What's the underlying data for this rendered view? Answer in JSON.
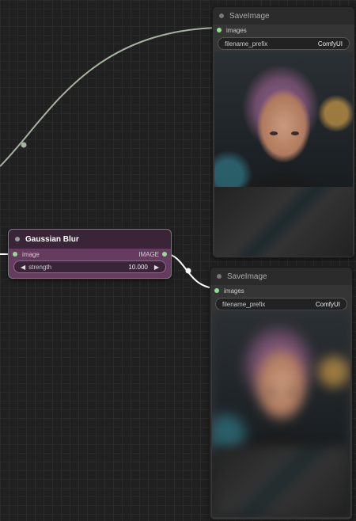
{
  "nodes": {
    "save_top": {
      "title": "SaveImage",
      "input_label": "images",
      "widget_label": "filename_prefix",
      "widget_value": "ComfyUI"
    },
    "blur": {
      "title": "Gaussian Blur",
      "input_label": "image",
      "output_label": "IMAGE",
      "widget_label": "strength",
      "widget_value": "10.000",
      "decrement_glyph": "◀",
      "increment_glyph": "▶"
    },
    "save_bottom": {
      "title": "SaveImage",
      "input_label": "images",
      "widget_label": "filename_prefix",
      "widget_value": "ComfyUI"
    }
  },
  "colors": {
    "canvas": "#202020",
    "node_bg": "#353535",
    "blur_node_bg": "#653c5f",
    "link_top": "#a7b3a2",
    "link_bottom": "#ffffff",
    "slot_dot": "#8ee08e"
  }
}
